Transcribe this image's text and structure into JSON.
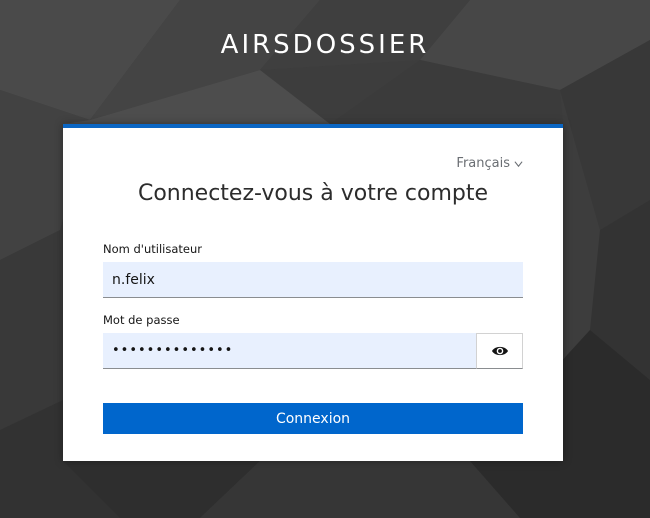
{
  "brand": {
    "name": "AIRSDOSSIER"
  },
  "login": {
    "language": "Français",
    "language_icon": "chevron-down-icon",
    "title": "Connectez-vous à votre compte",
    "username": {
      "label": "Nom d'utilisateur",
      "value": "n.felix"
    },
    "password": {
      "label": "Mot de passe",
      "value": "••••••••••••••",
      "toggle_icon": "eye-icon"
    },
    "submit_label": "Connexion"
  },
  "colors": {
    "accent": "#0066cc",
    "card_top_border": "#0b66c3",
    "input_background": "#e8f0fe",
    "background": "#3a3a3a"
  }
}
